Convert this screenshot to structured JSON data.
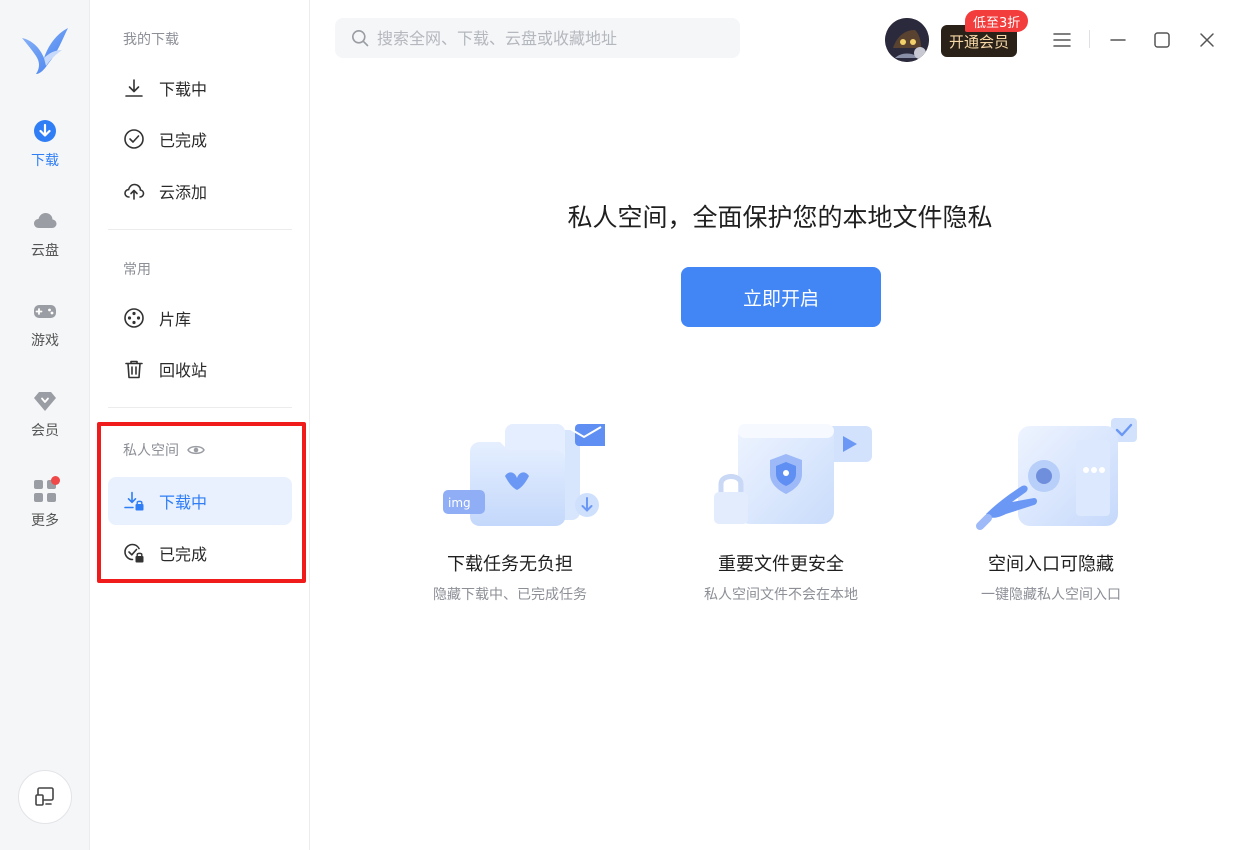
{
  "rail": {
    "items": [
      {
        "label": "下载",
        "icon": "download-circle-icon",
        "active": true
      },
      {
        "label": "云盘",
        "icon": "cloud-icon"
      },
      {
        "label": "游戏",
        "icon": "gamepad-icon"
      },
      {
        "label": "会员",
        "icon": "diamond-icon"
      },
      {
        "label": "更多",
        "icon": "apps-grid-icon"
      }
    ],
    "bottom_icon": "remote-screen-icon"
  },
  "nav": {
    "section_downloads": "我的下载",
    "downloads": [
      {
        "label": "下载中",
        "icon": "download-arrow-icon"
      },
      {
        "label": "已完成",
        "icon": "check-circle-icon"
      },
      {
        "label": "云添加",
        "icon": "cloud-upload-icon"
      }
    ],
    "section_common": "常用",
    "common": [
      {
        "label": "片库",
        "icon": "film-reel-icon"
      },
      {
        "label": "回收站",
        "icon": "trash-icon"
      }
    ],
    "section_private": "私人空间",
    "private": [
      {
        "label": "下载中",
        "icon": "download-lock-icon",
        "active": true
      },
      {
        "label": "已完成",
        "icon": "check-lock-icon"
      }
    ]
  },
  "topbar": {
    "search_placeholder": "搜索全网、下载、云盘或收藏地址",
    "vip_label": "开通会员",
    "vip_badge": "低至3折"
  },
  "main": {
    "title": "私人空间，全面保护您的本地文件隐私",
    "start_button": "立即开启",
    "features": [
      {
        "title": "下载任务无负担",
        "subtitle": "隐藏下载中、已完成任务"
      },
      {
        "title": "重要文件更安全",
        "subtitle": "私人空间文件不会在本地"
      },
      {
        "title": "空间入口可隐藏",
        "subtitle": "一键隐藏私人空间入口"
      }
    ]
  },
  "colors": {
    "accent": "#2f7ef6",
    "button": "#4286f5",
    "highlight": "#f01c1c",
    "badge": "#f33c3c"
  }
}
